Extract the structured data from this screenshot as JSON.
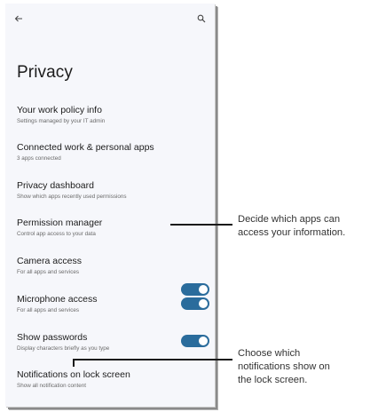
{
  "header": {
    "title": "Privacy",
    "back_icon": "arrow-left-icon",
    "search_icon": "search-icon"
  },
  "items": [
    {
      "title": "Your work policy info",
      "subtitle": "Settings managed by your IT admin"
    },
    {
      "title": "Connected work & personal apps",
      "subtitle": "3 apps connected"
    },
    {
      "title": "Privacy dashboard",
      "subtitle": "Show which apps recently used permissions"
    },
    {
      "title": "Permission manager",
      "subtitle": "Control app access to your data"
    },
    {
      "title": "Camera access",
      "subtitle": "For all apps and services",
      "toggle": true
    },
    {
      "title": "Microphone access",
      "subtitle": "For all apps and services",
      "toggle": true
    },
    {
      "title": "Show passwords",
      "subtitle": "Display characters briefly as you type",
      "toggle": true
    },
    {
      "title": "Notifications on lock screen",
      "subtitle": "Show all notification content"
    }
  ],
  "callouts": {
    "permission_lines": [
      "Decide which apps can",
      "access your information."
    ],
    "notifications_lines": [
      "Choose which",
      "notifications show on",
      "the lock screen."
    ]
  },
  "colors": {
    "toggle_on": "#2a6c9c",
    "screen_bg": "#f6f7fb"
  }
}
